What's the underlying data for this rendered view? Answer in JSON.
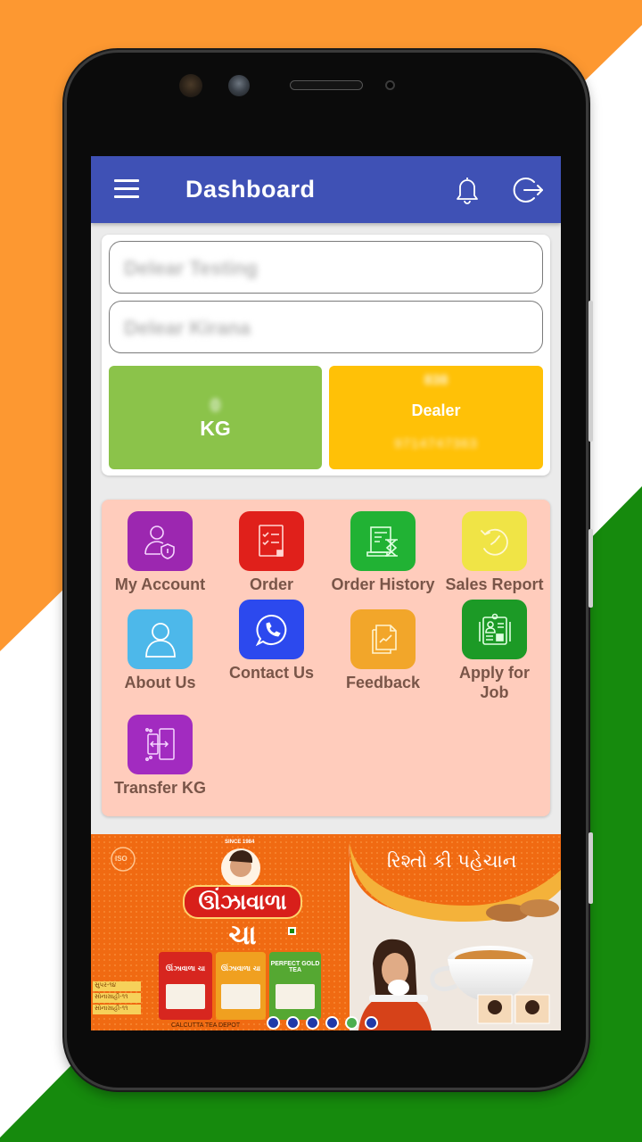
{
  "app": {
    "title": "Dashboard",
    "menu_icon": "hamburger-menu-icon",
    "notification_icon": "bell-icon",
    "logout_icon": "logout-icon",
    "appbar_color": "#3f51b5"
  },
  "profile": {
    "dealer_name": "Delear Testing",
    "shop_name": "Delear Kirana"
  },
  "stats": {
    "kg": {
      "value": "0",
      "unit": "KG",
      "color": "#8bc34a"
    },
    "dealer": {
      "code": "838",
      "label": "Dealer",
      "phone": "9714747363",
      "color": "#ffc107"
    }
  },
  "menu": {
    "panel_color": "#ffccbc",
    "label_color": "#795548",
    "items": [
      {
        "label": "My Account",
        "icon": "user-shield-icon",
        "color": "#9c27b0"
      },
      {
        "label": "Order",
        "icon": "checklist-icon",
        "color": "#e0201b"
      },
      {
        "label": "Order History",
        "icon": "document-hourglass-icon",
        "color": "#21b234"
      },
      {
        "label": "Sales Report",
        "icon": "clock-refresh-icon",
        "color": "#f0e446"
      },
      {
        "label": "About Us",
        "icon": "person-outline-icon",
        "color": "#4db8ea"
      },
      {
        "label": "Contact Us",
        "icon": "whatsapp-icon",
        "color": "#2c49ee"
      },
      {
        "label": "Feedback",
        "icon": "chart-documents-icon",
        "color": "#f2a62a"
      },
      {
        "label": "Apply for Job",
        "icon": "id-badge-clipboard-icon",
        "color": "#1c9a26"
      },
      {
        "label": "Transfer KG",
        "icon": "phone-transfer-icon",
        "color": "#a22bc0"
      }
    ]
  },
  "banner": {
    "brand": "ઊંઝાવાળા",
    "product": "ચા",
    "tagline": "રિશ્તો કી પહેચાન",
    "since": "SINCE 1984",
    "iso": "ISO",
    "packs": [
      "ઊંઝાવાળા ચા",
      "ઊંઝાવાળા ચા",
      "PERFECT GOLD TEA"
    ],
    "variants": [
      "સુપર-૧૪",
      "સોનાગ્રાહી-૧૧",
      "સોનાગ્રાહી-૧૧"
    ],
    "footer": "CALCUTTA TEA DEPOT",
    "carousel": {
      "count": 6,
      "active_index": 4,
      "dot_color": "#2039a8",
      "active_color": "#4caf50"
    }
  },
  "background": {
    "top": "#fd9831",
    "middle": "#ffffff",
    "bottom": "#168a0d"
  }
}
